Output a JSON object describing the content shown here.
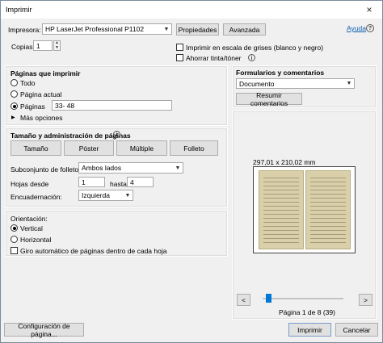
{
  "window": {
    "title": "Imprimir",
    "close_glyph": "×"
  },
  "printer": {
    "label": "Impresora:",
    "selected": "HP LaserJet Professional P1102",
    "properties_button": "Propiedades",
    "advanced_button": "Avanzada",
    "help_link": "Ayuda",
    "help_icon": "?"
  },
  "copies": {
    "label": "Copias:",
    "value": "1"
  },
  "options": {
    "grayscale_label": "Imprimir en escala de grises (blanco y negro)",
    "save_ink_label": "Ahorrar tinta/tóner",
    "info_glyph": "i"
  },
  "pages_to_print": {
    "heading": "Páginas que imprimir",
    "all_label": "Todo",
    "current_page_label": "Página actual",
    "pages_label": "Páginas",
    "pages_value": "33- 48",
    "more_options_label": "Más opciones",
    "selected": "pages"
  },
  "forms": {
    "heading": "Formularios y comentarios",
    "selected": "Documento",
    "summarize_button": "Resumir comentarios"
  },
  "sizing": {
    "heading": "Tamaño y administración de páginas",
    "info_glyph": "i",
    "buttons": [
      "Tamaño",
      "Póster",
      "Múltiple",
      "Folleto"
    ],
    "subset_label": "Subconjunto de folletos:",
    "subset_value": "Ambos lados",
    "sheets_from_label": "Hojas desde",
    "sheets_from_value": "1",
    "to_label": "hasta",
    "to_value": "4",
    "binding_label": "Encuadernación:",
    "binding_value": "Izquierda"
  },
  "orientation": {
    "heading": "Orientación:",
    "vertical_label": "Vertical",
    "horizontal_label": "Horizontal",
    "auto_rotate_label": "Giro automático de páginas dentro de cada hoja",
    "selected": "vertical"
  },
  "preview": {
    "paper_size": "297,01 x 210,02 mm",
    "prev_glyph": "<",
    "next_glyph": ">",
    "page_status": "Página 1 de 8 (39)",
    "slider_fraction": 0.04
  },
  "footer": {
    "page_setup_button": "Configuración de página...",
    "print_button": "Imprimir",
    "cancel_button": "Cancelar"
  },
  "colors": {
    "accent": "#0078d7",
    "link": "#0b5fb4"
  }
}
